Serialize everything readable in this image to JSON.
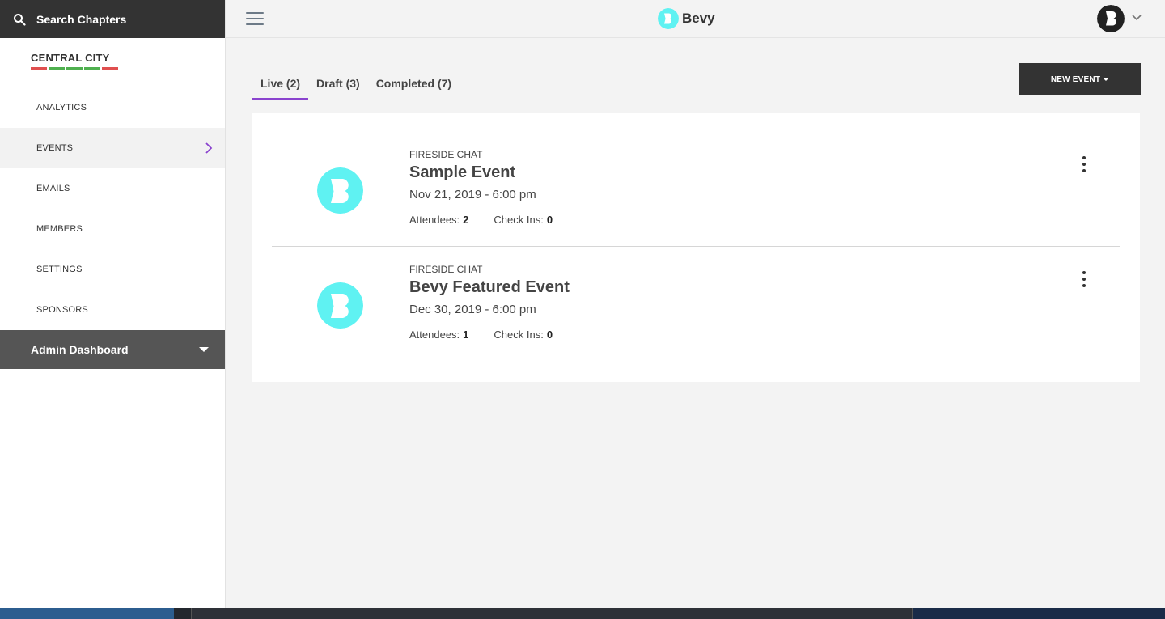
{
  "sidebar": {
    "search_label": "Search Chapters",
    "chapter_name": "CENTRAL CITY",
    "chapter_bar_colors": [
      "#e04f4f",
      "#4fb04f",
      "#4fb04f",
      "#4fb04f",
      "#e04f4f"
    ],
    "nav": [
      {
        "label": "ANALYTICS",
        "active": false
      },
      {
        "label": "EVENTS",
        "active": true
      },
      {
        "label": "EMAILS",
        "active": false
      },
      {
        "label": "MEMBERS",
        "active": false
      },
      {
        "label": "SETTINGS",
        "active": false
      },
      {
        "label": "SPONSORS",
        "active": false
      }
    ],
    "admin_label": "Admin Dashboard"
  },
  "header": {
    "brand_name": "Bevy",
    "brand_color": "#5ff2f2",
    "accent_color": "#8a43ce"
  },
  "main": {
    "tabs": [
      {
        "label": "Live (2)",
        "active": true
      },
      {
        "label": "Draft (3)",
        "active": false
      },
      {
        "label": "Completed (7)",
        "active": false
      }
    ],
    "new_event_label": "NEW EVENT",
    "events": [
      {
        "type": "FIRESIDE CHAT",
        "title": "Sample Event",
        "date": "Nov 21, 2019 - 6:00 pm",
        "attendees_label": "Attendees:",
        "attendees": "2",
        "checkins_label": "Check Ins:",
        "checkins": "0"
      },
      {
        "type": "FIRESIDE CHAT",
        "title": "Bevy Featured Event",
        "date": "Dec 30, 2019 - 6:00 pm",
        "attendees_label": "Attendees:",
        "attendees": "1",
        "checkins_label": "Check Ins:",
        "checkins": "0"
      }
    ]
  }
}
